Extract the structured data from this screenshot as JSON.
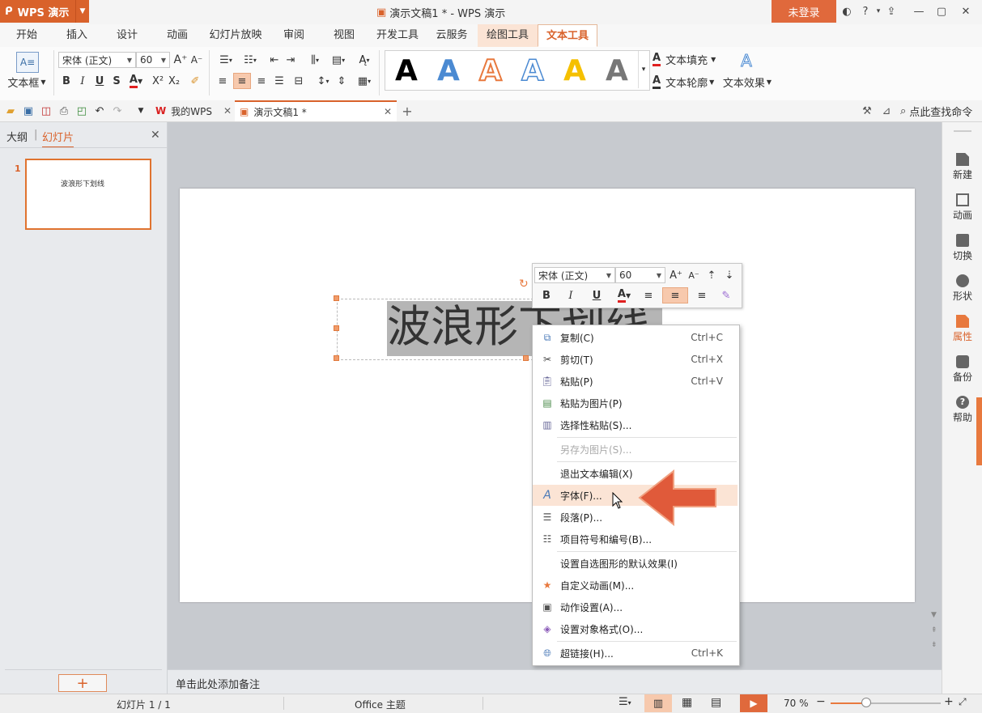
{
  "titlebar": {
    "app_name": "WPS 演示",
    "doc_title": "演示文稿1 * - WPS 演示",
    "login_label": "未登录"
  },
  "menu_tabs": [
    {
      "label": "开始"
    },
    {
      "label": "插入"
    },
    {
      "label": "设计"
    },
    {
      "label": "动画"
    },
    {
      "label": "幻灯片放映"
    },
    {
      "label": "审阅"
    },
    {
      "label": "视图"
    },
    {
      "label": "开发工具"
    },
    {
      "label": "云服务"
    },
    {
      "label": "绘图工具"
    },
    {
      "label": "文本工具"
    }
  ],
  "ribbon": {
    "textbox_label": "文本框",
    "font_name": "宋体 (正文)",
    "font_size": "60",
    "text_fill_label": "文本填充",
    "text_outline_label": "文本轮廓",
    "text_effect_label": "文本效果",
    "style_letter": "A"
  },
  "quick_tabs": {
    "tab1": "我的WPS",
    "tab2": "演示文稿1 *",
    "search_label": "点此查找命令"
  },
  "left_panel": {
    "tab_outline": "大纲",
    "tab_slides": "幻灯片",
    "slide_number": "1",
    "thumb_text": "波浪形下划线"
  },
  "slide": {
    "text": "波浪形下划线"
  },
  "float_toolbar": {
    "font_name": "宋体 (正文)",
    "font_size": "60"
  },
  "context_menu": {
    "items": [
      {
        "label": "复制(C)",
        "shortcut": "Ctrl+C"
      },
      {
        "label": "剪切(T)",
        "shortcut": "Ctrl+X"
      },
      {
        "label": "粘贴(P)",
        "shortcut": "Ctrl+V"
      },
      {
        "label": "粘贴为图片(P)",
        "shortcut": ""
      },
      {
        "label": "选择性粘贴(S)...",
        "shortcut": ""
      },
      {
        "label": "另存为图片(S)...",
        "shortcut": ""
      },
      {
        "label": "退出文本编辑(X)",
        "shortcut": ""
      },
      {
        "label": "字体(F)...",
        "shortcut": ""
      },
      {
        "label": "段落(P)...",
        "shortcut": ""
      },
      {
        "label": "项目符号和编号(B)...",
        "shortcut": ""
      },
      {
        "label": "设置自选图形的默认效果(I)",
        "shortcut": ""
      },
      {
        "label": "自定义动画(M)...",
        "shortcut": ""
      },
      {
        "label": "动作设置(A)...",
        "shortcut": ""
      },
      {
        "label": "设置对象格式(O)...",
        "shortcut": ""
      },
      {
        "label": "超链接(H)...",
        "shortcut": "Ctrl+K"
      }
    ]
  },
  "right_sidebar": [
    {
      "label": "新建"
    },
    {
      "label": "动画"
    },
    {
      "label": "切换"
    },
    {
      "label": "形状"
    },
    {
      "label": "属性"
    },
    {
      "label": "备份"
    },
    {
      "label": "帮助"
    }
  ],
  "notes_placeholder": "单击此处添加备注",
  "status": {
    "slide_info": "幻灯片 1 / 1",
    "theme": "Office 主题",
    "zoom": "70 %"
  },
  "colors": {
    "accent": "#d9622b",
    "login_bg": "#e0693c",
    "highlight": "#fbe4d5",
    "arrow": "#e05a3a"
  }
}
